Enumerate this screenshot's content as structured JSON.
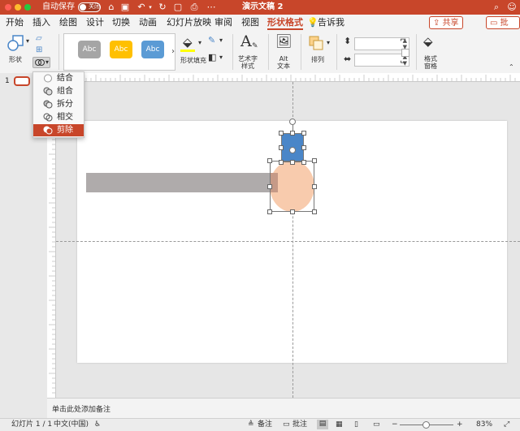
{
  "window": {
    "title": "演示文稿 2",
    "autosave_label": "自动保存",
    "autosave_state": "关闭"
  },
  "tabs": [
    {
      "label": "开始"
    },
    {
      "label": "插入"
    },
    {
      "label": "绘图"
    },
    {
      "label": "设计"
    },
    {
      "label": "切换"
    },
    {
      "label": "动画"
    },
    {
      "label": "幻灯片放映"
    },
    {
      "label": "审阅"
    },
    {
      "label": "视图"
    },
    {
      "label": "形状格式"
    }
  ],
  "tell_me": "告诉我",
  "share_label": "共享",
  "comments_label": "批注",
  "ribbon": {
    "shape_label": "形状",
    "style_samples": [
      "Abc",
      "Abc",
      "Abc"
    ],
    "fill_label": "形状填充",
    "wordart_label": "艺术字\n样式",
    "alt_text_label": "Alt\n文本",
    "arrange_label": "排列",
    "format_pane_label": "格式\n窗格"
  },
  "merge_menu": {
    "items": [
      {
        "label": "结合"
      },
      {
        "label": "组合"
      },
      {
        "label": "拆分"
      },
      {
        "label": "相交"
      },
      {
        "label": "剪除"
      }
    ],
    "highlighted_index": 4
  },
  "thumbnail_index": "1",
  "notes_placeholder": "单击此处添加备注",
  "status": {
    "slide_info": "幻灯片 1 / 1",
    "language": "中文(中国)",
    "notes_label": "备注",
    "comments_label": "批注",
    "zoom": "83%"
  },
  "colors": {
    "accent": "#C8462A",
    "style_gray": "#A5A5A5",
    "style_gold": "#FFC000",
    "style_blue": "#5B9BD5",
    "rect_gray": "#AFABAB",
    "circle_peach": "#F8CBAD",
    "square_blue": "#4A86C8"
  }
}
